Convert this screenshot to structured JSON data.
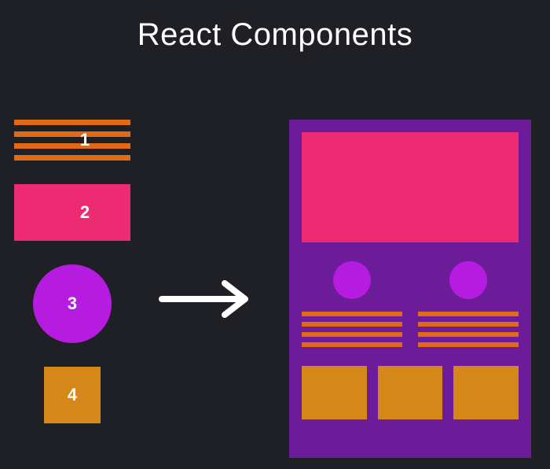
{
  "title": "React Components",
  "samples": {
    "s1": {
      "label": "1"
    },
    "s2": {
      "label": "2"
    },
    "s3": {
      "label": "3"
    },
    "s4": {
      "label": "4"
    }
  },
  "colors": {
    "bg": "#1f2026",
    "stripe": "#e06a17",
    "pink": "#ed2b72",
    "purple_light": "#b61be0",
    "purple_dark": "#6c1c99",
    "orange_square": "#d6871a",
    "text": "#ffffff"
  }
}
